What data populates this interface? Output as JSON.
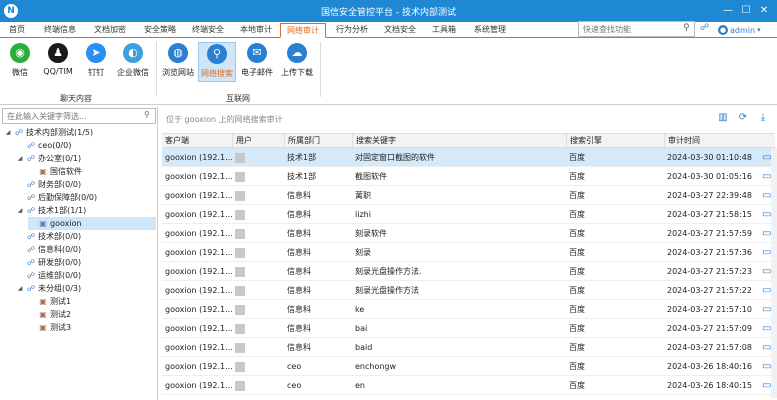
{
  "app": {
    "title": "国信安全管控平台 - 技术内部测试",
    "logo": "N"
  },
  "window_controls": {
    "minimize": "—",
    "maximize": "☐",
    "close": "✕"
  },
  "tabs": [
    {
      "label": "首页"
    },
    {
      "label": "终端信息"
    },
    {
      "label": "文档加密"
    },
    {
      "label": "安全策略"
    },
    {
      "label": "终端安全"
    },
    {
      "label": "本地审计"
    },
    {
      "label": "网络审计"
    },
    {
      "label": "行为分析"
    },
    {
      "label": "文档安全"
    },
    {
      "label": "工具箱"
    },
    {
      "label": "系统管理"
    }
  ],
  "quick_search": {
    "placeholder": "快速查找功能"
  },
  "user": {
    "name": "admin"
  },
  "ribbon": {
    "items": [
      {
        "label": "微信",
        "icon": "wechat-icon",
        "color": "#2aae3a",
        "glyph": "◉"
      },
      {
        "label": "QQ/TIM",
        "icon": "qq-icon",
        "color": "#1a1a1a",
        "glyph": "♟"
      },
      {
        "label": "钉钉",
        "icon": "dingtalk-icon",
        "color": "#2a8ff0",
        "glyph": "➤"
      },
      {
        "label": "企业微信",
        "icon": "wework-icon",
        "color": "#3ba0e0",
        "glyph": "◐"
      },
      {
        "label": "浏览网站",
        "icon": "globe-icon",
        "color": "#2a7fd0",
        "glyph": "◍"
      },
      {
        "label": "网络搜索",
        "icon": "search-globe-icon",
        "color": "#2a7fd0",
        "glyph": "⚲"
      },
      {
        "label": "电子邮件",
        "icon": "email-icon",
        "color": "#2a7fd0",
        "glyph": "✉"
      },
      {
        "label": "上传下载",
        "icon": "cloud-icon",
        "color": "#2a7fd0",
        "glyph": "☁"
      }
    ],
    "groups": [
      {
        "label": "聊天内容"
      },
      {
        "label": "互联网"
      }
    ]
  },
  "tree": {
    "search_placeholder": "在此输入关键字筛选...",
    "nodes": [
      {
        "label": "技术内部测试(1/5)",
        "twist": "◢",
        "type": "org"
      },
      {
        "label": "ceo(0/0)",
        "twist": "",
        "type": "org"
      },
      {
        "label": "办公室(0/1)",
        "twist": "◢",
        "type": "org"
      },
      {
        "label": "国信软件",
        "twist": "",
        "type": "pc-off"
      },
      {
        "label": "财务部(0/0)",
        "twist": "",
        "type": "org"
      },
      {
        "label": "后勤保障部(0/0)",
        "twist": "",
        "type": "org"
      },
      {
        "label": "技术1部(1/1)",
        "twist": "◢",
        "type": "org"
      },
      {
        "label": "gooxion",
        "twist": "",
        "type": "pc"
      },
      {
        "label": "技术部(0/0)",
        "twist": "",
        "type": "org"
      },
      {
        "label": "信息科(0/0)",
        "twist": "",
        "type": "org"
      },
      {
        "label": "研发部(0/0)",
        "twist": "",
        "type": "org"
      },
      {
        "label": "运维部(0/0)",
        "twist": "",
        "type": "org"
      },
      {
        "label": "未分组(0/3)",
        "twist": "◢",
        "type": "org"
      },
      {
        "label": "测试1",
        "twist": "",
        "type": "pc-off"
      },
      {
        "label": "测试2",
        "twist": "",
        "type": "pc-off"
      },
      {
        "label": "测试3",
        "twist": "",
        "type": "pc-off"
      }
    ]
  },
  "main": {
    "breadcrumb": "位于 gooxion 上的网络搜索审计",
    "columns": [
      "客户端",
      "用户",
      "所属部门",
      "搜索关键字",
      "搜索引擎",
      "审计时间"
    ],
    "rows": [
      {
        "client": "gooxion (192.1...",
        "dept": "技术1部",
        "keyword": "对固定窗口截图的软件",
        "engine": "百度",
        "time": "2024-03-30 01:10:48"
      },
      {
        "client": "gooxion (192.1...",
        "dept": "技术1部",
        "keyword": "截图软件",
        "engine": "百度",
        "time": "2024-03-30 01:05:16"
      },
      {
        "client": "gooxion (192.1...",
        "dept": "信息科",
        "keyword": "蓠职",
        "engine": "百度",
        "time": "2024-03-27 22:39:48"
      },
      {
        "client": "gooxion (192.1...",
        "dept": "信息科",
        "keyword": "lizhi",
        "engine": "百度",
        "time": "2024-03-27 21:58:15"
      },
      {
        "client": "gooxion (192.1...",
        "dept": "信息科",
        "keyword": "刻录软件",
        "engine": "百度",
        "time": "2024-03-27 21:57:59"
      },
      {
        "client": "gooxion (192.1...",
        "dept": "信息科",
        "keyword": "刻录",
        "engine": "百度",
        "time": "2024-03-27 21:57:36"
      },
      {
        "client": "gooxion (192.1...",
        "dept": "信息科",
        "keyword": "刻录光盘操作方法.",
        "engine": "百度",
        "time": "2024-03-27 21:57:23"
      },
      {
        "client": "gooxion (192.1...",
        "dept": "信息科",
        "keyword": "刻录光盘操作方法",
        "engine": "百度",
        "time": "2024-03-27 21:57:22"
      },
      {
        "client": "gooxion (192.1...",
        "dept": "信息科",
        "keyword": "ke",
        "engine": "百度",
        "time": "2024-03-27 21:57:10"
      },
      {
        "client": "gooxion (192.1...",
        "dept": "信息科",
        "keyword": "bai",
        "engine": "百度",
        "time": "2024-03-27 21:57:09"
      },
      {
        "client": "gooxion (192.1...",
        "dept": "信息科",
        "keyword": "baid",
        "engine": "百度",
        "time": "2024-03-27 21:57:08"
      },
      {
        "client": "gooxion (192.1...",
        "dept": "ceo",
        "keyword": "enchongw",
        "engine": "百度",
        "time": "2024-03-26 18:40:16"
      },
      {
        "client": "gooxion (192.1...",
        "dept": "ceo",
        "keyword": "en",
        "engine": "百度",
        "time": "2024-03-26 18:40:15"
      }
    ]
  },
  "colors": {
    "titlebar": "#1e88d2",
    "accent": "#e06a1a",
    "selection": "#d6e9f8"
  }
}
